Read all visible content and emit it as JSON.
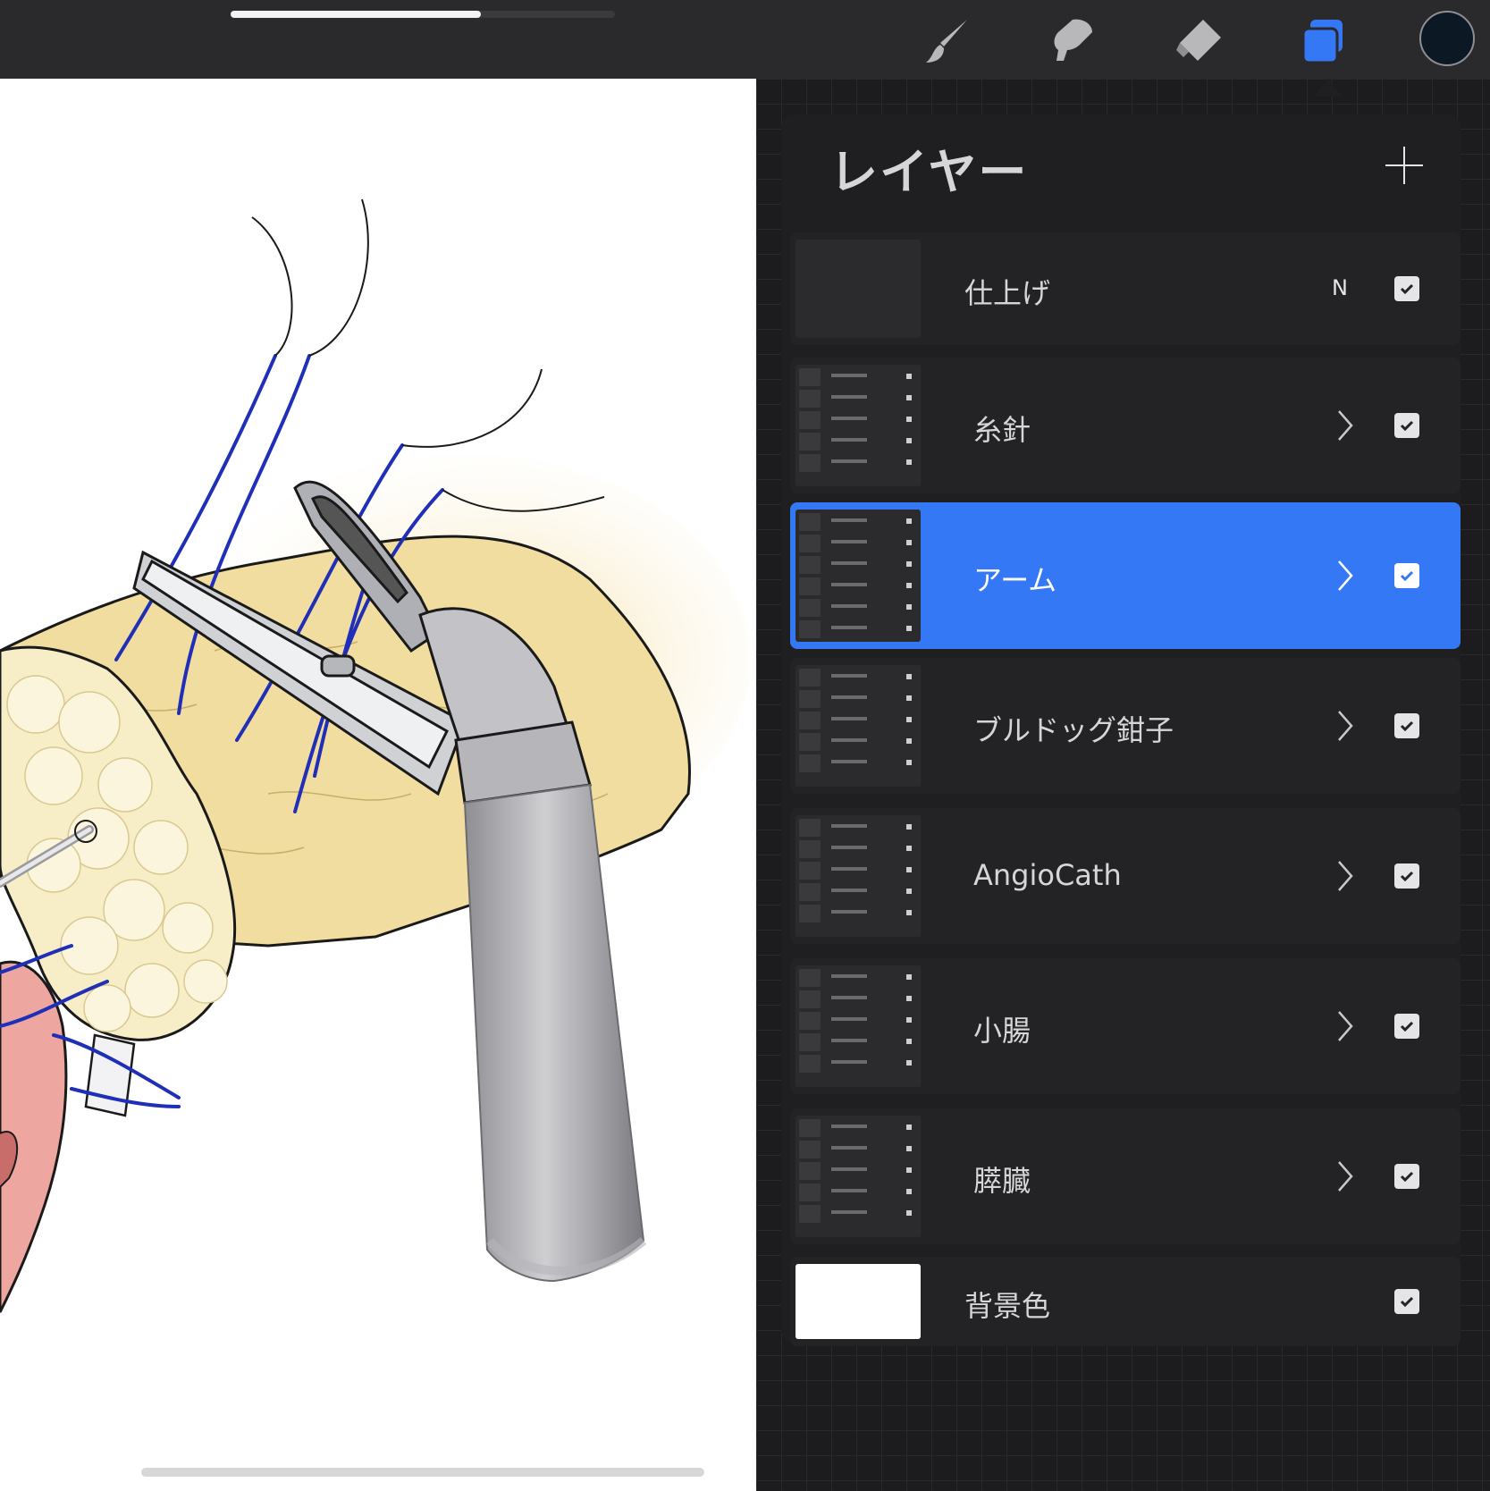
{
  "toolbar": {
    "tools": [
      "brush-icon",
      "smudge-icon",
      "eraser-icon",
      "layers-icon"
    ],
    "active_tool": "layers-icon",
    "accent_color": "#3478f6",
    "current_color": "#0c1824",
    "progress": 0.65
  },
  "layers_panel": {
    "title": "レイヤー",
    "add_button_icon": "plus-icon",
    "layers": [
      {
        "name": "仕上げ",
        "blend": "N",
        "visible": true,
        "group": false
      },
      {
        "name": "糸針",
        "visible": true,
        "group": true
      },
      {
        "name": "アーム",
        "visible": true,
        "group": true,
        "selected": true
      },
      {
        "name": "ブルドッグ鉗子",
        "visible": true,
        "group": true
      },
      {
        "name": "AngioCath",
        "visible": true,
        "group": true
      },
      {
        "name": "小腸",
        "visible": true,
        "group": true
      },
      {
        "name": "膵臓",
        "visible": true,
        "group": true
      },
      {
        "name": "背景色",
        "visible": true,
        "group": false
      }
    ]
  }
}
